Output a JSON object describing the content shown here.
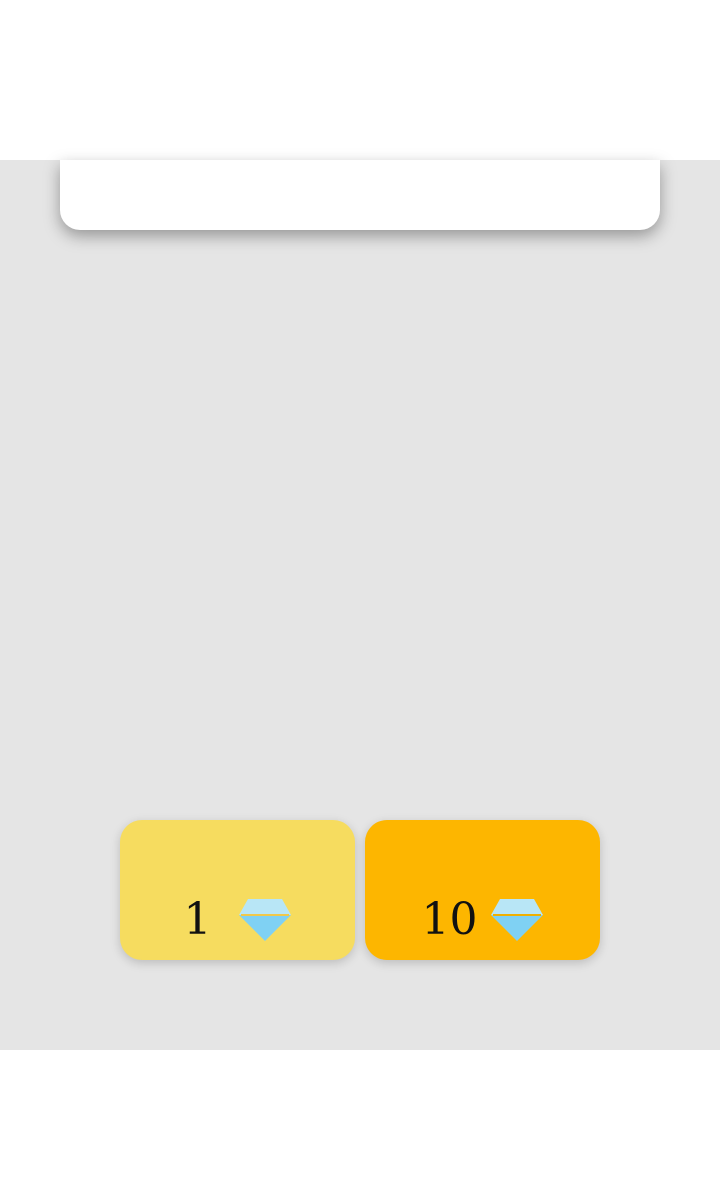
{
  "colors": {
    "page_bg": "#ffffff",
    "panel_bg": "#e5e5e5",
    "card_bg": "#ffffff",
    "buy_one_bg": "#f6dc5f",
    "buy_ten_bg": "#fdb600",
    "gem_light": "#b8e6f6",
    "gem_dark": "#7fd1f3"
  },
  "purchase_buttons": [
    {
      "amount": "1",
      "icon": "diamond-icon"
    },
    {
      "amount": "10",
      "icon": "diamond-icon"
    }
  ]
}
